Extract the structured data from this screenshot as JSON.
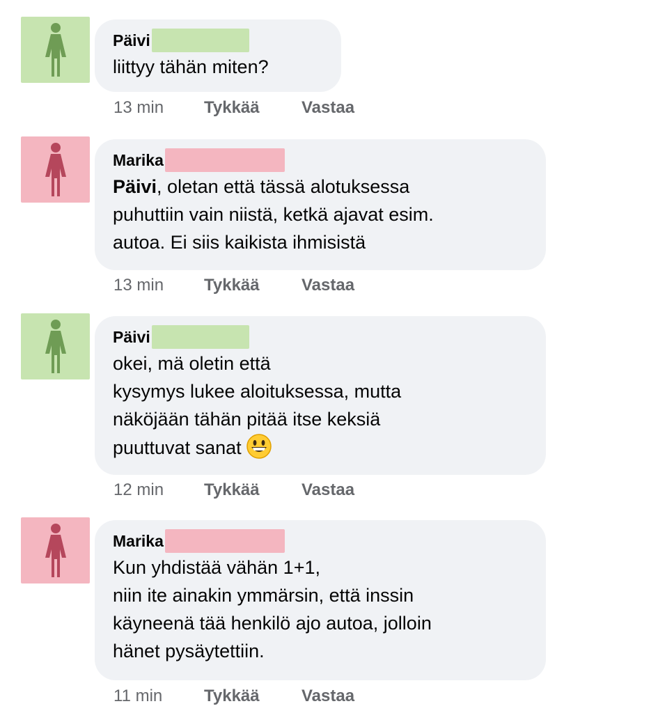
{
  "colors": {
    "bubble_bg": "#f0f2f5",
    "meta_text": "#65676b",
    "green_avatar_bg": "#c7e4b0",
    "green_avatar_icon": "#6f9c55",
    "pink_avatar_bg": "#f4b6c0",
    "pink_avatar_icon": "#b5475c"
  },
  "comments": [
    {
      "author": "Päivi",
      "avatar_icon": "female-person-icon",
      "lines": [
        "liittyy tähän miten?"
      ],
      "time": "13 min",
      "like_label": "Tykkää",
      "reply_label": "Vastaa"
    },
    {
      "author": "Marika",
      "avatar_icon": "female-person-icon",
      "mention": "Päivi",
      "lines": [
        ", oletan että tässä alotuksessa",
        "puhuttiin vain niistä, ketkä ajavat esim.",
        "autoa. Ei siis kaikista ihmisistä"
      ],
      "time": "13 min",
      "like_label": "Tykkää",
      "reply_label": "Vastaa"
    },
    {
      "author": "Päivi",
      "avatar_icon": "female-person-icon",
      "lines": [
        "okei, mä oletin että",
        "kysymys lukee aloituksessa, mutta",
        "näköjään tähän pitää itse keksiä",
        "puuttuvat sanat"
      ],
      "emoji": "grinning-face-emoji",
      "time": "12 min",
      "like_label": "Tykkää",
      "reply_label": "Vastaa"
    },
    {
      "author": "Marika",
      "avatar_icon": "female-person-icon",
      "lines": [
        "Kun yhdistää vähän 1+1,",
        "niin ite ainakin ymmärsin, että inssin",
        "käyneenä tää henkilö ajo autoa, jolloin",
        "hänet pysäytettiin."
      ],
      "time": "11 min",
      "like_label": "Tykkää",
      "reply_label": "Vastaa"
    }
  ]
}
